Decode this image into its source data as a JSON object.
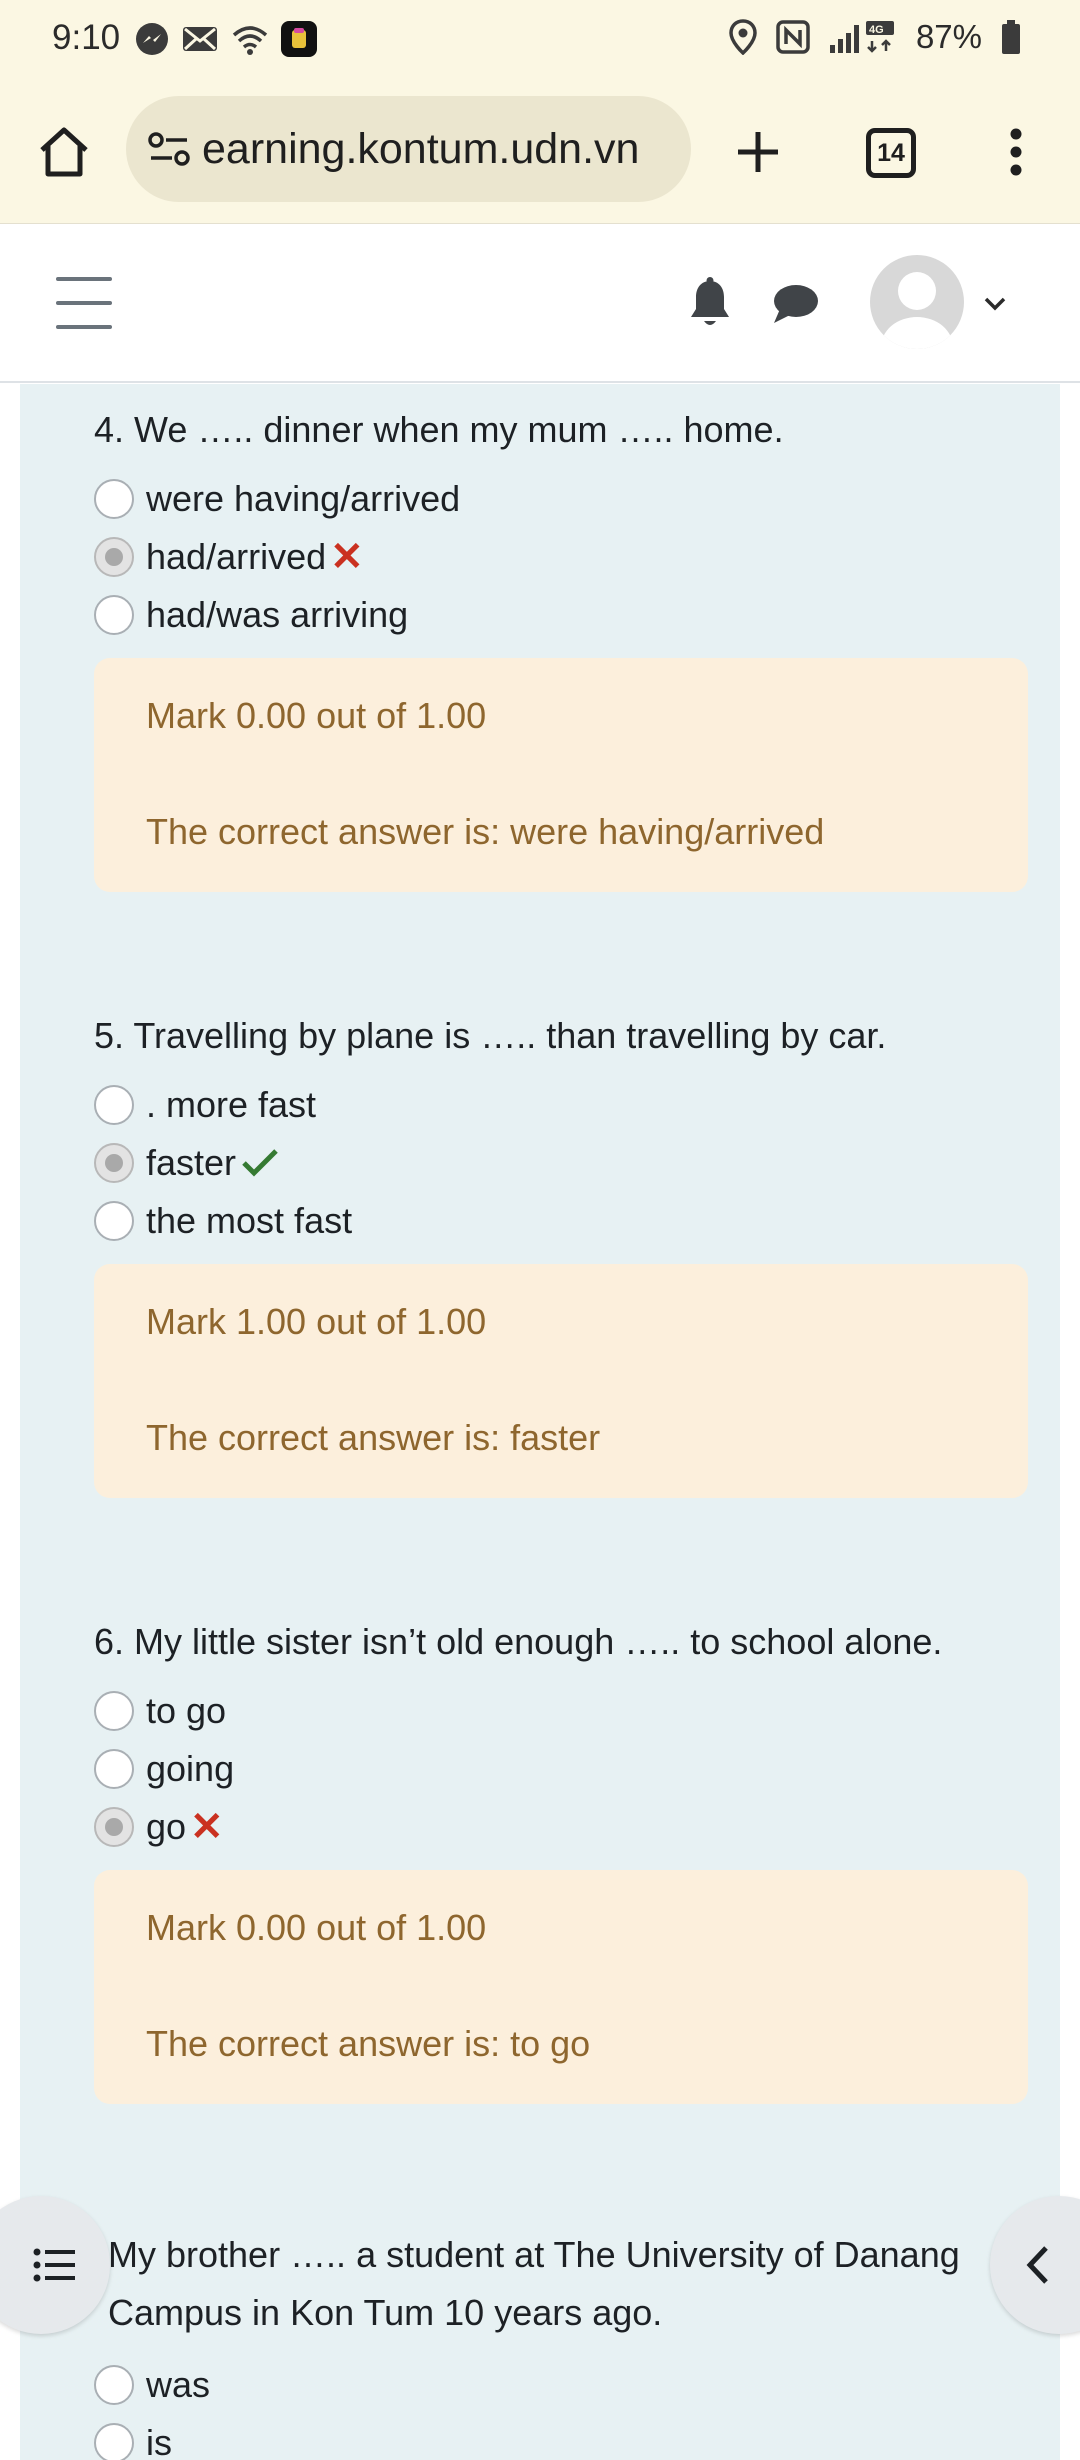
{
  "status_bar": {
    "time": "9:10",
    "battery": "87%",
    "icons": [
      "messenger-icon",
      "mail-icon",
      "wifi-icon",
      "app-icon",
      "location-icon",
      "nfc-icon",
      "signal-icon",
      "battery-icon"
    ]
  },
  "browser": {
    "url": "earning.kontum.udn.vn",
    "tab_count": "14"
  },
  "navbar": {
    "icons": [
      "menu-icon",
      "bell-icon",
      "chat-icon",
      "avatar",
      "chevron-down-icon"
    ]
  },
  "questions": [
    {
      "text": "4. We ….. dinner when my mum ….. home.",
      "options": [
        {
          "label": "were having/arrived",
          "selected": false,
          "result": ""
        },
        {
          "label": "had/arrived",
          "selected": true,
          "result": "incorrect"
        },
        {
          "label": "had/was arriving",
          "selected": false,
          "result": ""
        }
      ],
      "mark": "Mark 0.00 out of 1.00",
      "correct": "The correct answer is: were having/arrived"
    },
    {
      "text": "5. Travelling by plane is ….. than travelling by car.",
      "options": [
        {
          "label": ". more fast",
          "selected": false,
          "result": ""
        },
        {
          "label": "faster",
          "selected": true,
          "result": "correct"
        },
        {
          "label": "the most fast",
          "selected": false,
          "result": ""
        }
      ],
      "mark": "Mark 1.00 out of 1.00",
      "correct": "The correct answer is: faster"
    },
    {
      "text": "6. My little sister isn’t old enough ….. to school alone.",
      "options": [
        {
          "label": "to go",
          "selected": false,
          "result": ""
        },
        {
          "label": "going",
          "selected": false,
          "result": ""
        },
        {
          "label": "go",
          "selected": true,
          "result": "incorrect"
        }
      ],
      "mark": "Mark 0.00 out of 1.00",
      "correct": "The correct answer is: to go"
    },
    {
      "text": "My brother ….. a student at The University of Danang Campus in Kon Tum 10 years ago.",
      "options": [
        {
          "label": "was",
          "selected": false,
          "result": ""
        },
        {
          "label": "is",
          "selected": false,
          "result": ""
        }
      ]
    }
  ],
  "colors": {
    "browser_chrome": "#fbf7e3",
    "content_bg": "#e7f1f3",
    "feedback_bg": "#fcefdc",
    "feedback_text": "#8e662e",
    "incorrect": "#ca3120",
    "correct": "#357a32"
  }
}
